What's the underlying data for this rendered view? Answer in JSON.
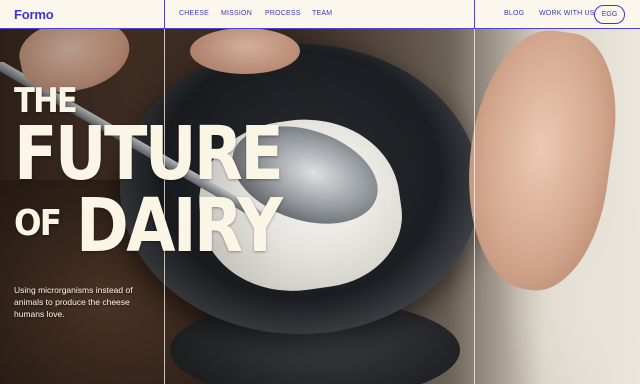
{
  "brand": {
    "logo": "Formo"
  },
  "nav": {
    "left_links": [
      "CHEESE",
      "MISSION",
      "PROCESS",
      "TEAM"
    ],
    "right_links": [
      "BLOG",
      "WORK WITH US"
    ],
    "cta": "EGG"
  },
  "hero": {
    "headline": {
      "line1": "THE",
      "line2": "FUTURE",
      "line3_small": "OF",
      "line3_big": "DAIRY"
    },
    "tagline": "Using microrganisms instead of animals to produce the cheese humans love."
  },
  "colors": {
    "accent": "#3d38c8",
    "nav_bg": "#fbf7ec",
    "headline": "#fbf5e6"
  }
}
